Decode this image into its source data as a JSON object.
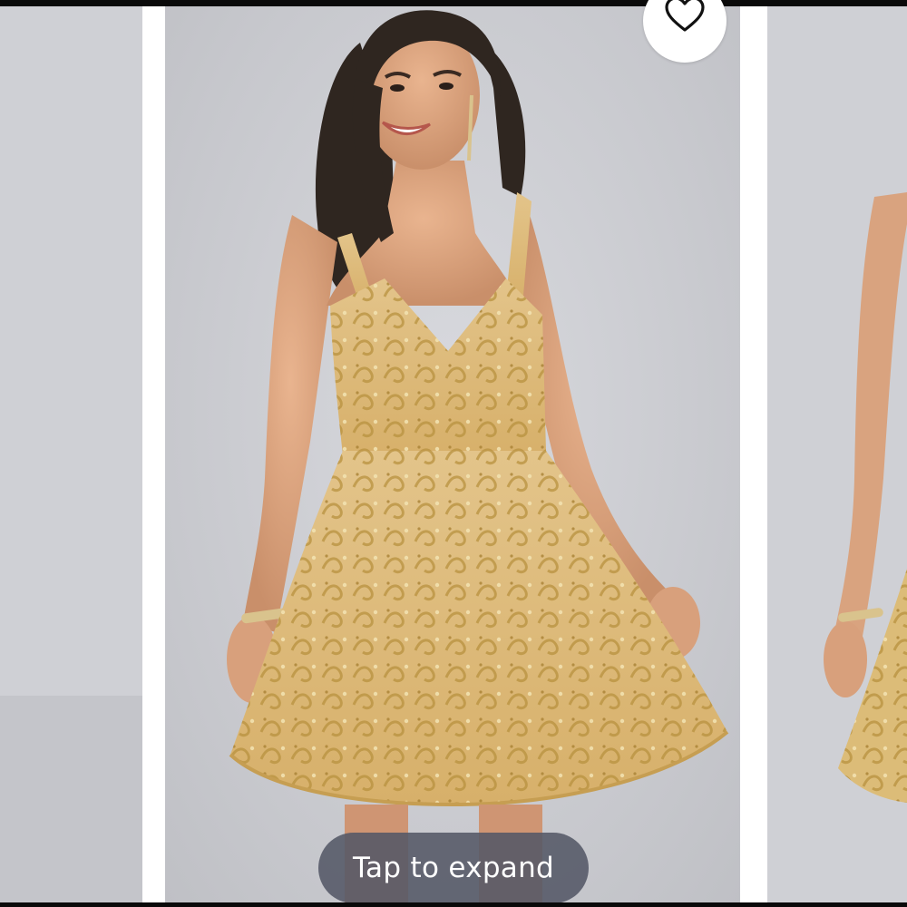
{
  "carousel": {
    "slides": [
      {
        "id": "previous",
        "content": "photo"
      },
      {
        "id": "current",
        "content": "photo"
      },
      {
        "id": "next",
        "content": "photo"
      }
    ]
  },
  "favorite": {
    "icon": "heart-icon"
  },
  "expand": {
    "label": "Tap to expand"
  },
  "colors": {
    "background": "#ffffff",
    "photo_backdrop": "#c9cace",
    "dress_gold": "#d8b871",
    "pill": "#545866"
  }
}
